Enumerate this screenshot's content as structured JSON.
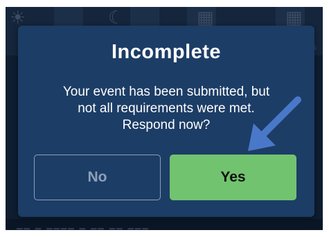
{
  "dialog": {
    "title": "Incomplete",
    "message_lines": [
      "Your event has been submitted, but",
      "not all requirements were met.",
      "Respond now?"
    ],
    "no_label": "No",
    "yes_label": "Yes"
  },
  "background": {
    "partial_label": "ys"
  },
  "icons": {
    "annotation": "arrow-pointer-icon",
    "bg_left": "sun-icon",
    "bg_mid": "moon-icon",
    "bg_right": "calendar-icon"
  },
  "colors": {
    "dialog_bg": "#1c3d66",
    "yes_button": "#72c36f",
    "no_button_border": "#8ea0b8",
    "annotation_arrow": "#4a78c8"
  }
}
